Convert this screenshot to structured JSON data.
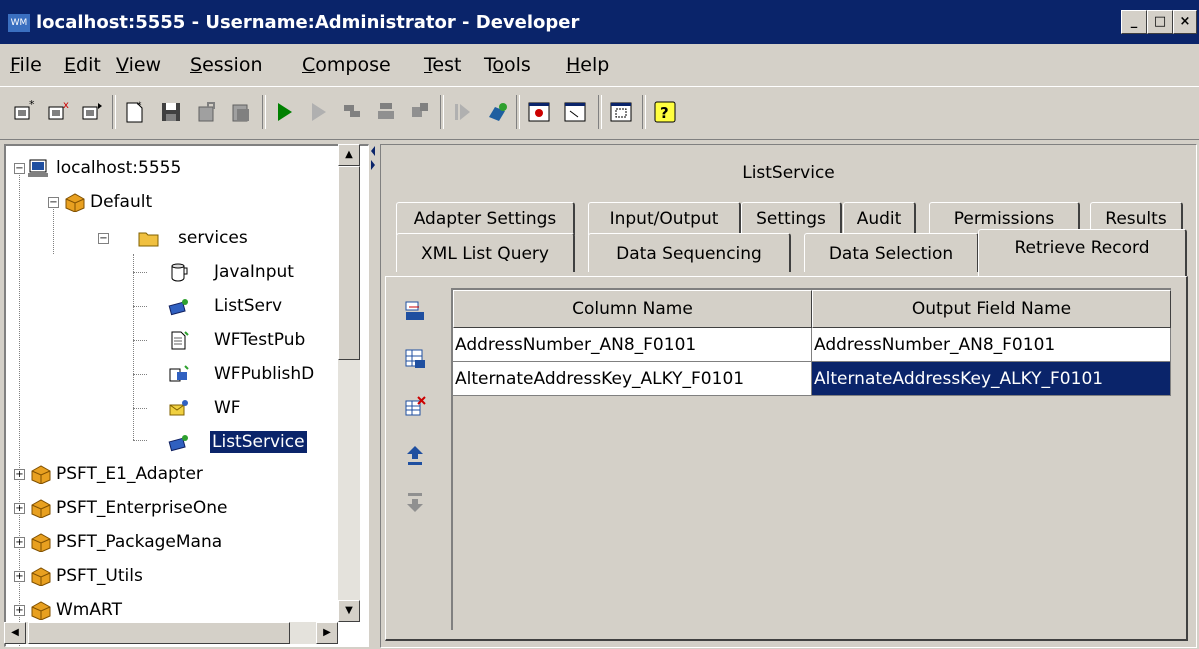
{
  "window": {
    "title": "localhost:5555 - Username:Administrator - Developer",
    "icon_text": "WM",
    "controls": [
      "_",
      "□",
      "×"
    ]
  },
  "menu": [
    "File",
    "Edit",
    "View",
    "Session",
    "Compose",
    "Test",
    "Tools",
    "Help"
  ],
  "menu_mnemonics": [
    "F",
    "E",
    "V",
    "S",
    "C",
    "T",
    "o",
    "H"
  ],
  "toolbar": {
    "icons": [
      "open-session-icon",
      "close-session-icon",
      "refresh-session-icon",
      "new-icon",
      "save-icon",
      "lock-icon",
      "unlock-icon",
      "run-icon",
      "step-icon",
      "step-into-icon",
      "step-over-icon",
      "step-out-icon",
      "resume-icon",
      "reload-icon",
      "browser-icon",
      "window-icon",
      "fit-icon",
      "help-icon"
    ]
  },
  "tree": {
    "root": "localhost:5555",
    "items": [
      {
        "label": "Default",
        "icon": "package-icon"
      },
      {
        "label": "services",
        "icon": "folder-icon"
      },
      {
        "label": "JavaInput",
        "icon": "java-service-icon"
      },
      {
        "label": "ListServ",
        "icon": "adapter-service-icon"
      },
      {
        "label": "WFTestPub",
        "icon": "document-icon"
      },
      {
        "label": "WFPublishD",
        "icon": "publish-icon"
      },
      {
        "label": "WF",
        "icon": "notification-icon"
      },
      {
        "label": "ListService",
        "icon": "adapter-service-icon"
      },
      {
        "label": "PSFT_E1_Adapter",
        "icon": "package-icon"
      },
      {
        "label": "PSFT_EnterpriseOne",
        "icon": "package-icon"
      },
      {
        "label": "PSFT_PackageMana",
        "icon": "package-icon"
      },
      {
        "label": "PSFT_Utils",
        "icon": "package-icon"
      },
      {
        "label": "WmART",
        "icon": "package-icon"
      }
    ],
    "selected": "ListService"
  },
  "editor": {
    "title": "ListService",
    "tabs_row1": [
      "Adapter Settings",
      "Input/Output",
      "Settings",
      "Audit",
      "Permissions",
      "Results"
    ],
    "tabs_row2": [
      "XML List Query",
      "Data Sequencing",
      "Data Selection",
      "Retrieve Record"
    ],
    "active_tab": "Retrieve Record",
    "side_icons": [
      "insert-row-icon",
      "add-row-icon",
      "delete-row-icon",
      "move-up-icon",
      "move-down-icon"
    ],
    "table": {
      "columns": [
        "Column Name",
        "Output Field Name"
      ],
      "rows": [
        [
          "AddressNumber_AN8_F0101",
          "AddressNumber_AN8_F0101"
        ],
        [
          "AlternateAddressKey_ALKY_F0101",
          "AlternateAddressKey_ALKY_F0101"
        ]
      ],
      "selected_cell": "AlternateAddressKey_ALKY_F0101"
    }
  },
  "colors": {
    "titlebar": "#0a246a",
    "face": "#d4d0c8",
    "selection": "#0a246a"
  }
}
